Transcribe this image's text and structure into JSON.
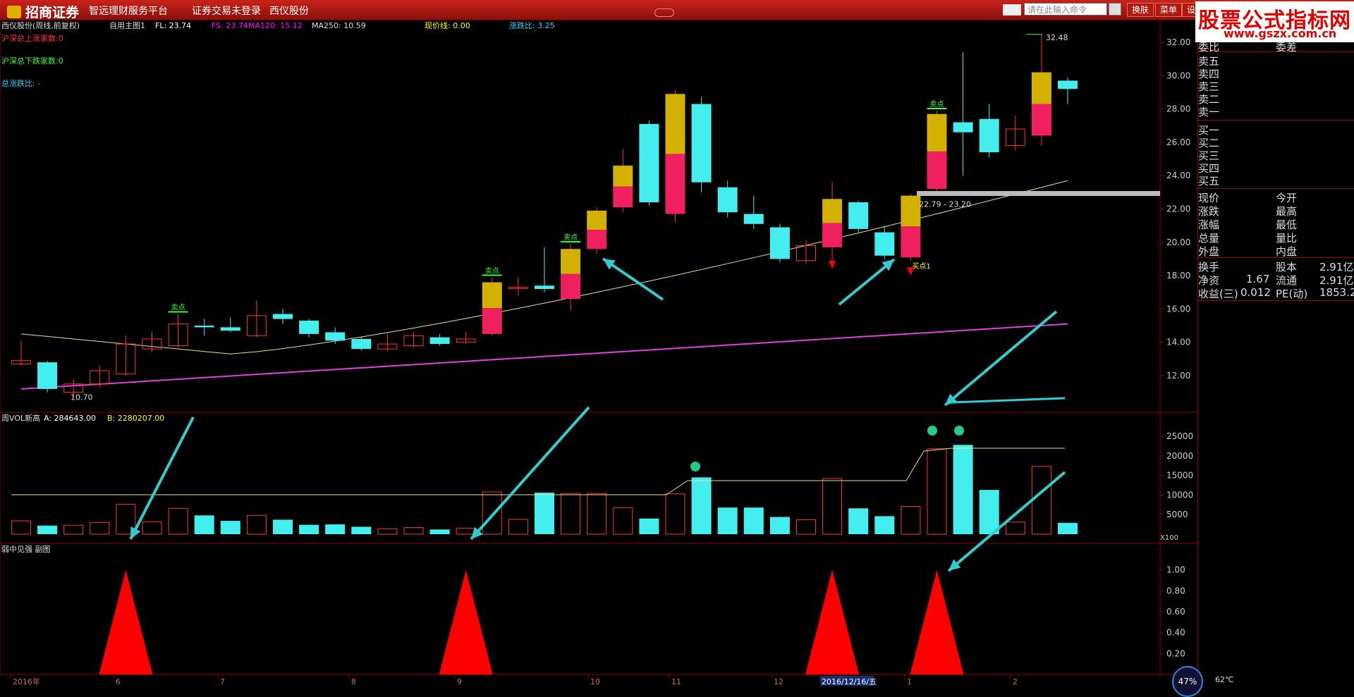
{
  "titlebar": {
    "brand": "招商证券",
    "platform": "智远理财服务平台",
    "login_status": "证券交易未登录",
    "stock_name": "西仪股份",
    "search_placeholder": "请在此输入命令",
    "btn_switch": "换肤",
    "btn_menu": "菜单",
    "btn_settings": "设"
  },
  "watermark": {
    "line1": "股票公式指标网",
    "line2": "www.gszx.com.cn"
  },
  "main_chart": {
    "header": "西仪股份(周线,前复权)",
    "main_index": "自用主图1",
    "fl": "FL: 23.74",
    "fs": "FS: 23.74",
    "ma120": "MA120: 15.12",
    "ma250": "MA250: 10.59",
    "cur_line": "现价线: 0.00",
    "ratio": "涨跌比: 3.25",
    "up_count": "沪深总上涨家数:0",
    "down_count": "沪深总下跌家数:0",
    "total_ratio": "总涨跌比: -",
    "price_ticks": [
      "32.00",
      "30.00",
      "28.00",
      "26.00",
      "24.00",
      "22.00",
      "20.00",
      "18.00",
      "16.00",
      "14.00",
      "12.00"
    ],
    "max_label": "32.48",
    "min_label": "10.70",
    "range_label": "22.79 - 23.20",
    "sell_label": "卖点",
    "buy_label": "买点1"
  },
  "vol_panel": {
    "header": "周VOL新高",
    "a_value": "A: 284643.00",
    "b_value": "B: 2280207.00",
    "ticks": [
      "25000",
      "20000",
      "15000",
      "10000",
      "5000"
    ],
    "unit": "X100"
  },
  "sub_panel": {
    "header": "弱中见强 副图",
    "ticks": [
      "1.00",
      "0.80",
      "0.60",
      "0.40",
      "0.20"
    ]
  },
  "date_axis": {
    "labels": [
      "2016年",
      "6",
      "7",
      "8",
      "9",
      "10",
      "11",
      "12",
      "2016/12/16/五",
      "1",
      "2"
    ]
  },
  "right_panel": {
    "sell_ratio": "委比",
    "sell_diff": "委差",
    "asks": [
      "卖五",
      "卖四",
      "卖三",
      "卖二",
      "卖一"
    ],
    "bids": [
      "买一",
      "买二",
      "买三",
      "买四",
      "买五"
    ],
    "quote_left": [
      "现价",
      "涨跌",
      "涨幅",
      "总量",
      "外盘"
    ],
    "quote_right": [
      "今开",
      "最高",
      "最低",
      "量比",
      "内盘"
    ],
    "f1": {
      "label": "换手",
      "label2": "股本",
      "value2": "2.91亿"
    },
    "f2": {
      "label": "净资",
      "value": "1.67",
      "label2": "流通",
      "value2": "2.91亿"
    },
    "f3": {
      "label": "收益(三)",
      "value": "0.012",
      "label2": "PE(动)",
      "value2": "1853.2"
    }
  },
  "status": {
    "cpu": "47%",
    "temp": "62℃"
  },
  "chart_data": {
    "type": "candlestick",
    "price_range": [
      11,
      32.5
    ],
    "candles": [
      {
        "o": 12.7,
        "c": 12.9,
        "h": 14.1,
        "l": 12.6
      },
      {
        "o": 12.8,
        "c": 11.2,
        "h": 12.9,
        "l": 11.0
      },
      {
        "o": 11.0,
        "c": 11.5,
        "h": 11.8,
        "l": 10.7
      },
      {
        "o": 11.5,
        "c": 12.3,
        "h": 12.6,
        "l": 11.3
      },
      {
        "o": 12.1,
        "c": 13.9,
        "h": 14.4,
        "l": 12.0
      },
      {
        "o": 13.6,
        "c": 14.2,
        "h": 14.6,
        "l": 13.4
      },
      {
        "o": 13.8,
        "c": 15.1,
        "h": 15.7,
        "l": 13.7
      },
      {
        "o": 15.0,
        "c": 14.9,
        "h": 15.4,
        "l": 14.4
      },
      {
        "o": 14.9,
        "c": 14.7,
        "h": 15.5,
        "l": 14.6
      },
      {
        "o": 14.4,
        "c": 15.6,
        "h": 16.5,
        "l": 14.3
      },
      {
        "o": 15.7,
        "c": 15.4,
        "h": 16.0,
        "l": 15.1
      },
      {
        "o": 15.3,
        "c": 14.5,
        "h": 15.4,
        "l": 14.3
      },
      {
        "o": 14.6,
        "c": 14.1,
        "h": 14.9,
        "l": 13.9
      },
      {
        "o": 14.2,
        "c": 13.6,
        "h": 14.3,
        "l": 13.5
      },
      {
        "o": 13.6,
        "c": 13.9,
        "h": 14.5,
        "l": 13.5
      },
      {
        "o": 13.8,
        "c": 14.4,
        "h": 14.6,
        "l": 13.7
      },
      {
        "o": 14.3,
        "c": 13.9,
        "h": 14.5,
        "l": 13.8
      },
      {
        "o": 14.0,
        "c": 14.2,
        "h": 14.6,
        "l": 13.9
      },
      {
        "o": 14.5,
        "c": 17.6,
        "h": 17.9,
        "l": 14.4
      },
      {
        "o": 17.3,
        "c": 17.3,
        "h": 17.9,
        "l": 16.8
      },
      {
        "o": 17.4,
        "c": 17.2,
        "h": 19.7,
        "l": 17.0
      },
      {
        "o": 16.6,
        "c": 19.6,
        "h": 19.9,
        "l": 15.9
      },
      {
        "o": 19.6,
        "c": 21.9,
        "h": 22.1,
        "l": 19.3
      },
      {
        "o": 22.1,
        "c": 24.6,
        "h": 25.6,
        "l": 21.8
      },
      {
        "o": 27.1,
        "c": 22.4,
        "h": 27.3,
        "l": 22.2
      },
      {
        "o": 21.7,
        "c": 28.9,
        "h": 29.1,
        "l": 21.2
      },
      {
        "o": 28.3,
        "c": 23.6,
        "h": 28.7,
        "l": 23.0
      },
      {
        "o": 23.3,
        "c": 21.8,
        "h": 23.7,
        "l": 21.5
      },
      {
        "o": 21.7,
        "c": 21.1,
        "h": 22.8,
        "l": 20.8
      },
      {
        "o": 20.9,
        "c": 19.0,
        "h": 21.1,
        "l": 18.8
      },
      {
        "o": 18.9,
        "c": 19.8,
        "h": 20.1,
        "l": 18.7
      },
      {
        "o": 19.7,
        "c": 22.6,
        "h": 23.6,
        "l": 18.9
      },
      {
        "o": 22.4,
        "c": 20.8,
        "h": 22.5,
        "l": 20.6
      },
      {
        "o": 20.6,
        "c": 19.2,
        "h": 21.0,
        "l": 19.0
      },
      {
        "o": 19.1,
        "c": 22.8,
        "h": 22.9,
        "l": 18.9
      },
      {
        "o": 23.2,
        "c": 27.7,
        "h": 27.9,
        "l": 23.1
      },
      {
        "o": 27.2,
        "c": 26.6,
        "h": 31.4,
        "l": 24.0
      },
      {
        "o": 27.4,
        "c": 25.4,
        "h": 28.3,
        "l": 25.1
      },
      {
        "o": 25.8,
        "c": 26.8,
        "h": 27.6,
        "l": 25.5
      },
      {
        "o": 26.4,
        "c": 30.2,
        "h": 32.5,
        "l": 25.8
      },
      {
        "o": 29.7,
        "c": 29.2,
        "h": 29.9,
        "l": 28.3
      }
    ],
    "volume": [
      3400,
      2200,
      2300,
      3000,
      7600,
      3200,
      6600,
      4800,
      3400,
      4800,
      3700,
      2400,
      2500,
      1900,
      1400,
      1700,
      1200,
      1500,
      10800,
      3800,
      10600,
      10400,
      10400,
      6800,
      4000,
      10300,
      14500,
      6800,
      6800,
      4400,
      3700,
      14200,
      6600,
      4600,
      7100,
      21800,
      22800,
      11300,
      3100,
      17300,
      2900
    ],
    "signal_peaks": [
      4,
      17,
      31,
      35
    ]
  }
}
